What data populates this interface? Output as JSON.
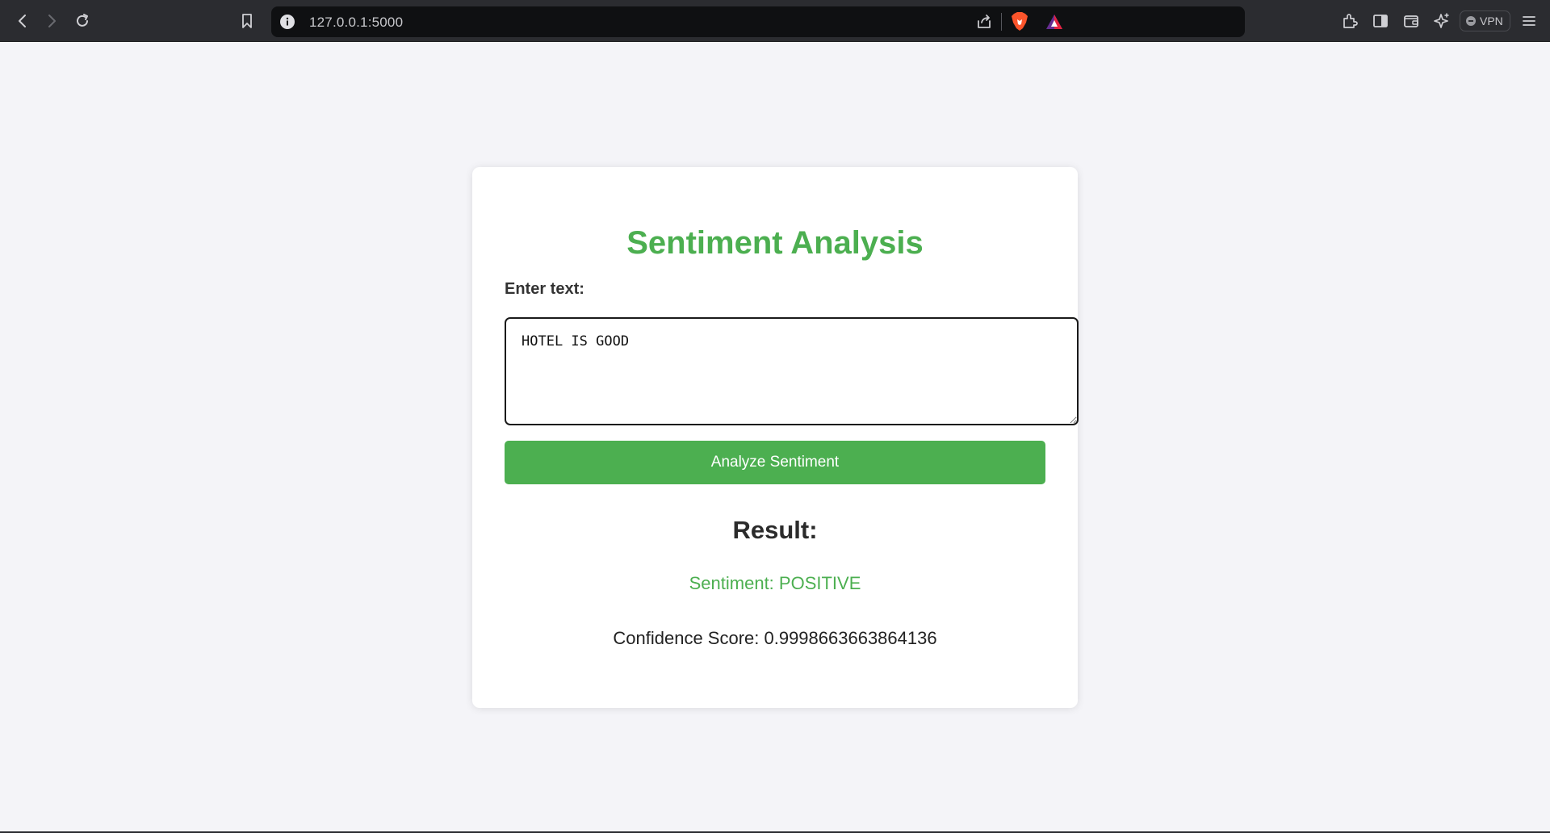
{
  "browser": {
    "url": "127.0.0.1:5000",
    "vpn_label": "VPN",
    "icons": {
      "back": "chevron-left-icon",
      "forward": "chevron-right-icon",
      "reload": "reload-icon",
      "bookmark": "bookmark-icon",
      "site_info": "info-icon",
      "share": "share-icon",
      "brave_shields": "brave-lion-icon",
      "rewards": "rewards-triangle-icon",
      "extensions": "puzzle-icon",
      "sidebar": "sidebar-icon",
      "wallet": "wallet-icon",
      "leo": "sparkle-icon",
      "menu": "hamburger-menu-icon"
    }
  },
  "page": {
    "title": "Sentiment Analysis",
    "input_label": "Enter text:",
    "input_value": "HOTEL IS GOOD",
    "button_label": "Analyze Sentiment",
    "result_heading": "Result:",
    "sentiment_text": "Sentiment: POSITIVE",
    "confidence_text": "Confidence Score: 0.9998663663864136"
  },
  "colors": {
    "accent": "#4caf50",
    "background": "#f4f4f8",
    "card": "#ffffff",
    "chrome": "#2b2c30"
  }
}
